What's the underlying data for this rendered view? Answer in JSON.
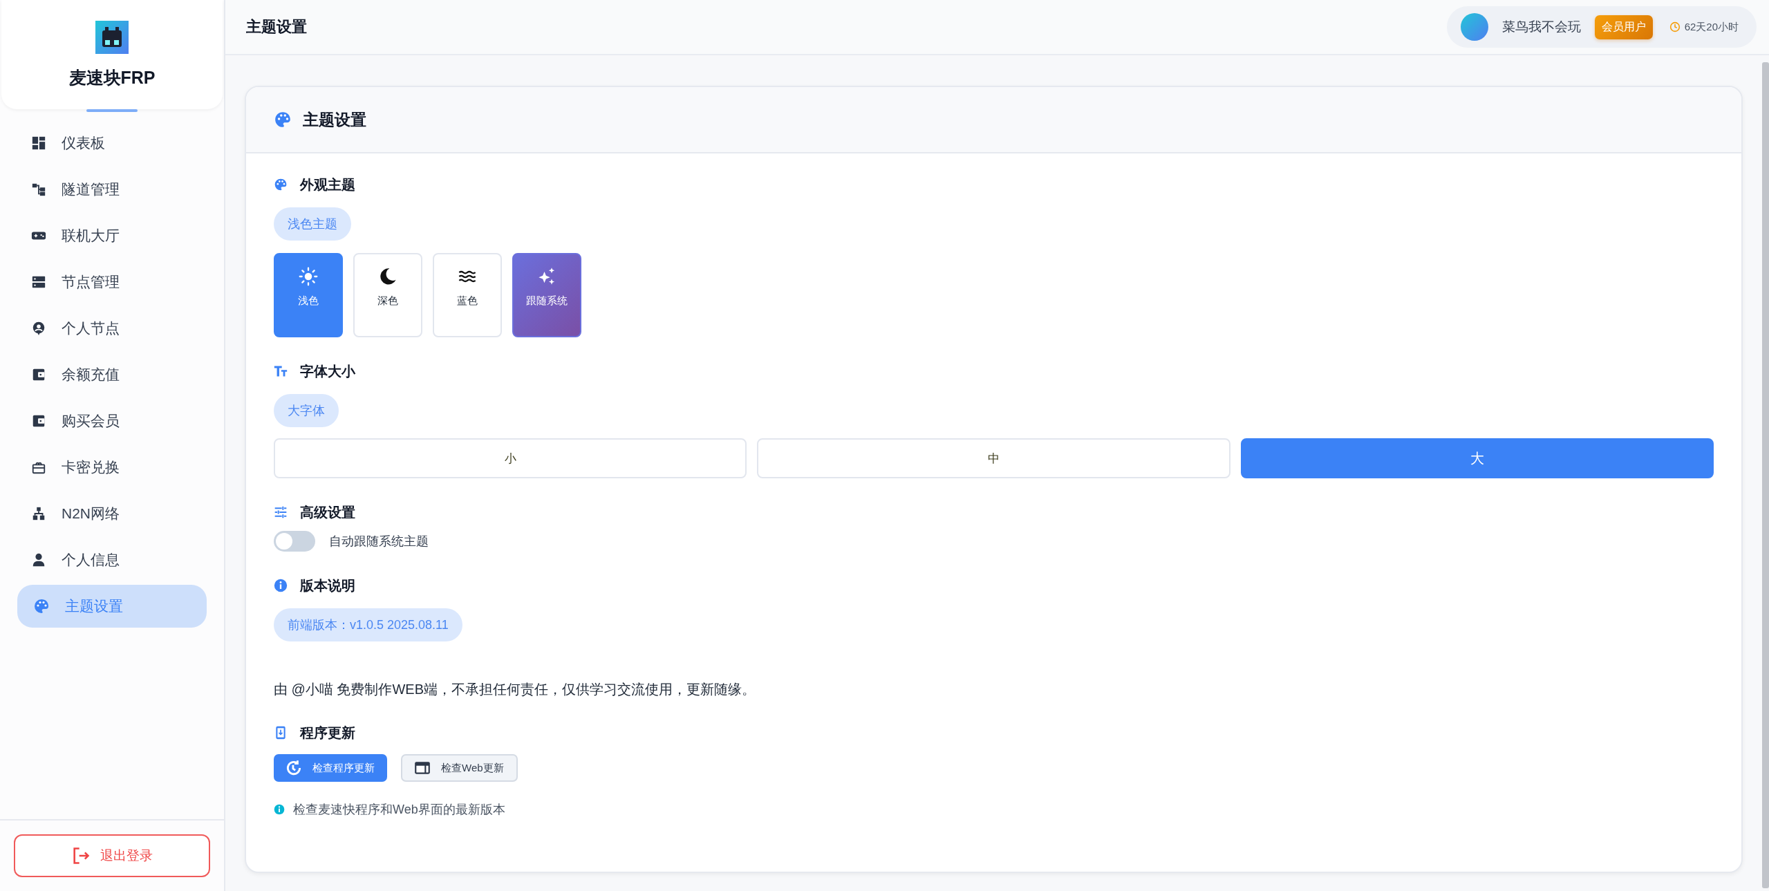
{
  "sidebar": {
    "brand": "麦速块FRP",
    "items": [
      {
        "label": "仪表板",
        "selected": false
      },
      {
        "label": "隧道管理",
        "selected": false
      },
      {
        "label": "联机大厅",
        "selected": false
      },
      {
        "label": "节点管理",
        "selected": false
      },
      {
        "label": "个人节点",
        "selected": false
      },
      {
        "label": "余额充值",
        "selected": false
      },
      {
        "label": "购买会员",
        "selected": false
      },
      {
        "label": "卡密兑换",
        "selected": false
      },
      {
        "label": "N2N网络",
        "selected": false
      },
      {
        "label": "个人信息",
        "selected": false
      },
      {
        "label": "主题设置",
        "selected": true
      }
    ],
    "logout": "退出登录"
  },
  "header": {
    "title": "主题设置",
    "user": {
      "name": "菜鸟我不会玩",
      "badge": "会员用户",
      "remaining": "62天20小时"
    }
  },
  "card": {
    "title": "主题设置",
    "appearance": {
      "title": "外观主题",
      "current": "浅色主题",
      "options": [
        {
          "kind": "light",
          "label": "浅色",
          "selected": true
        },
        {
          "kind": "dark",
          "label": "深色",
          "selected": false
        },
        {
          "kind": "blue",
          "label": "蓝色",
          "selected": false
        },
        {
          "kind": "system",
          "label": "跟随系统",
          "selected": false
        }
      ]
    },
    "font_size": {
      "title": "字体大小",
      "current": "大字体",
      "options": [
        {
          "label": "小",
          "selected": false
        },
        {
          "label": "中",
          "selected": false
        },
        {
          "label": "大",
          "selected": true
        }
      ]
    },
    "advanced": {
      "title": "高级设置",
      "toggle": {
        "label": "自动跟随系统主题",
        "on": false
      }
    },
    "version": {
      "title": "版本说明",
      "chip": "前端版本：v1.0.5 2025.08.11",
      "note": "由 @小喵 免费制作WEB端，不承担任何责任，仅供学习交流使用，更新随缘。"
    },
    "update": {
      "title": "程序更新",
      "buttons": [
        {
          "kind": "primary",
          "label": "检查程序更新"
        },
        {
          "kind": "secondary",
          "label": "检查Web更新"
        }
      ],
      "hint": "检查麦速快程序和Web界面的最新版本"
    }
  }
}
